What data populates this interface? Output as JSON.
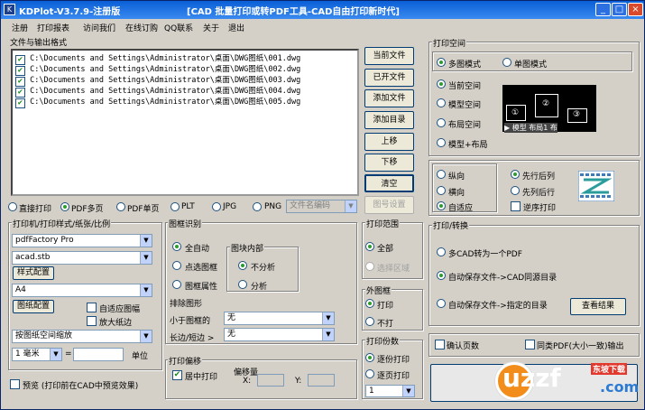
{
  "title": {
    "app": "KDPlot-V3.7.9-注册版",
    "text": "[CAD 批量打印或转PDF工具-CAD自由打印新时代]"
  },
  "menu": [
    "注册",
    "打印报表",
    "访问我们",
    "在线订购",
    "QQ联系",
    "关于",
    "退出"
  ],
  "files": {
    "label": "文件与输出格式",
    "items": [
      "C:\\Documents and Settings\\Administrator\\桌面\\DWG图纸\\001.dwg",
      "C:\\Documents and Settings\\Administrator\\桌面\\DWG图纸\\002.dwg",
      "C:\\Documents and Settings\\Administrator\\桌面\\DWG图纸\\003.dwg",
      "C:\\Documents and Settings\\Administrator\\桌面\\DWG图纸\\004.dwg",
      "C:\\Documents and Settings\\Administrator\\桌面\\DWG图纸\\005.dwg"
    ]
  },
  "file_buttons": {
    "current": "当前文件",
    "opened": "已开文件",
    "add_file": "添加文件",
    "add_dir": "添加目录",
    "up": "上移",
    "down": "下移",
    "clear": "清空",
    "number": "图号设置"
  },
  "output": {
    "direct": "直接打印",
    "pdf_multi": "PDF多页",
    "pdf_single": "PDF单页",
    "plt": "PLT",
    "jpg": "JPG",
    "png": "PNG",
    "name_encoding": "文件名编码"
  },
  "printer": {
    "label": "打印机/打印样式/纸张/比例",
    "printer": "pdfFactory Pro",
    "style": "acad.stb",
    "style_btn": "样式配置",
    "paper": "A4",
    "paper_btn": "图纸配置",
    "auto_fit": "自适应图幅",
    "enlarge": "放大纸边",
    "scale_mode": "按图纸空间缩放",
    "scale_val": "1 毫米",
    "eq": "=",
    "unit": "单位"
  },
  "preview": "预览 (打印前在CAD中预览效果)",
  "frame": {
    "label": "图框识别",
    "auto": "全自动",
    "pick": "点选图框",
    "attr": "图框属性",
    "block_label": "图块内部",
    "no_split": "不分析",
    "split": "分析",
    "excl_label": "排除图形",
    "lt_label": "小于图框的",
    "lt_val": "无",
    "edge_label": "长边/短边 >",
    "edge_val": "无"
  },
  "offset": {
    "label": "打印偏移",
    "center": "居中打印",
    "offset": "偏移量",
    "x": "X:",
    "y": "Y:"
  },
  "range": {
    "label": "打印范围",
    "all": "全部",
    "select": "选择区域"
  },
  "outer": {
    "label": "外图框",
    "print": "打印",
    "noprint": "不打"
  },
  "copies": {
    "label": "打印份数",
    "by_copy": "逐份打印",
    "by_page": "逐页打印",
    "count": "1"
  },
  "space": {
    "label": "打印空间",
    "multi": "多图模式",
    "single": "单图模式",
    "current": "当前空间",
    "model": "模型空间",
    "layout": "布局空间",
    "model_layout": "模型+布局",
    "pic_labels": [
      "①",
      "②",
      "③"
    ],
    "pic_tabs": "▶ 模型 布局1 布"
  },
  "orient": {
    "portrait": "纵向",
    "landscape": "横向",
    "auto": "自适应",
    "first_row": "先行后列",
    "first_col": "先列后行",
    "reverse": "逆序打印"
  },
  "convert": {
    "label": "打印/转换",
    "multi_one": "多CAD转为一个PDF",
    "auto_same": "自动保存文件->CAD同源目录",
    "auto_dir": "自动保存文件->指定的目录",
    "view_result": "查看结果"
  },
  "bottom": {
    "confirm_pages": "确认页数",
    "same_pdf": "同类PDF(大小一致)输出"
  },
  "watermark": {
    "brand": "uzzf",
    "sub": "东坡下载",
    ".com": ".com"
  }
}
